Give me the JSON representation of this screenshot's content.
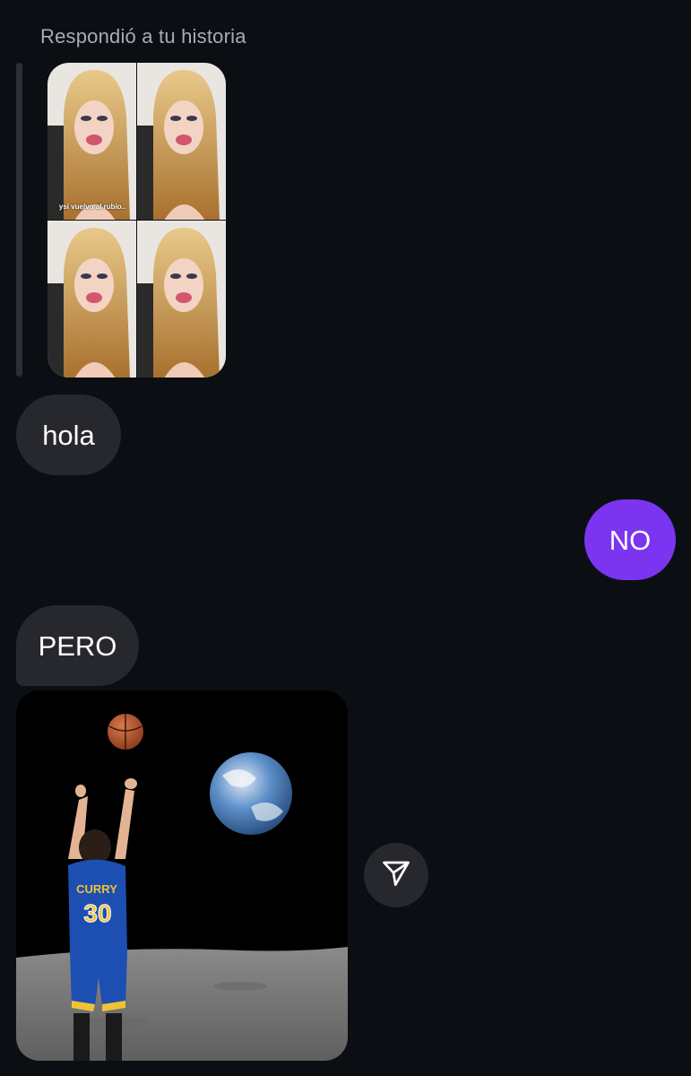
{
  "reply": {
    "header_text": "Respondió a tu historia",
    "story_caption": "ysi vuelvo al rubio.."
  },
  "messages": [
    {
      "direction": "incoming",
      "text": "hola"
    },
    {
      "direction": "outgoing",
      "text": "NO"
    },
    {
      "direction": "incoming",
      "text": "PERO"
    }
  ],
  "meme": {
    "jersey_name": "CURRY",
    "jersey_number": "30"
  },
  "icons": {
    "share": "paper-plane-icon"
  },
  "colors": {
    "background": "#0b0f14",
    "incoming_bubble": "#26282d",
    "outgoing_bubble": "#7b35f0",
    "meta_text": "#a7adb5"
  }
}
